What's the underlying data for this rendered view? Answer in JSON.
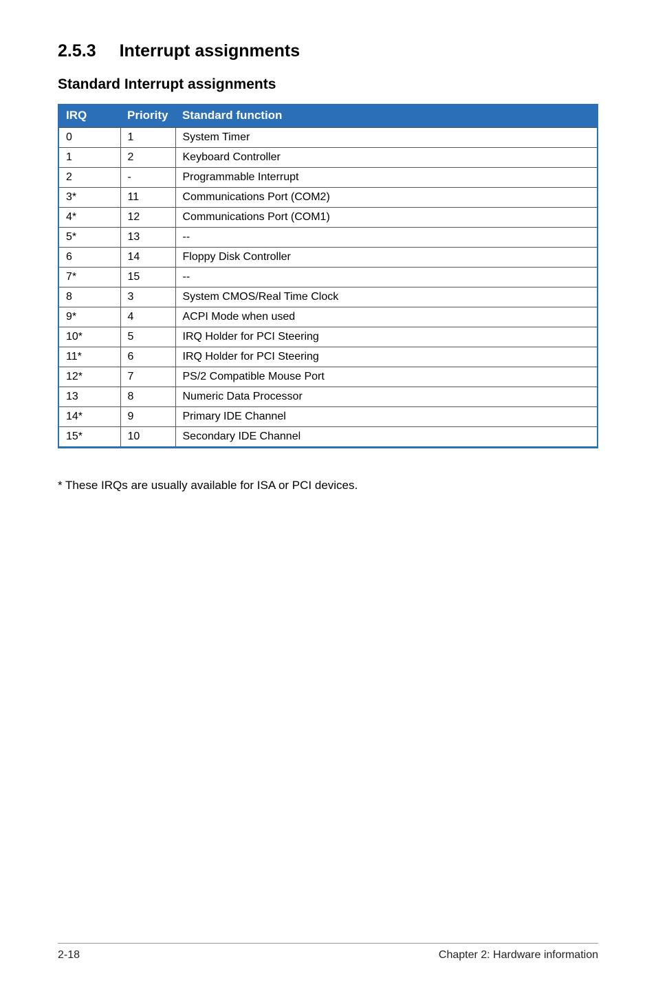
{
  "heading": {
    "number": "2.5.3",
    "title": "Interrupt assignments"
  },
  "subheading": "Standard Interrupt assignments",
  "table": {
    "headers": {
      "irq": "IRQ",
      "priority": "Priority",
      "func": "Standard function"
    },
    "rows": [
      {
        "irq": "0",
        "priority": "1",
        "func": "System Timer"
      },
      {
        "irq": "1",
        "priority": "2",
        "func": "Keyboard Controller"
      },
      {
        "irq": "2",
        "priority": "-",
        "func": "Programmable Interrupt"
      },
      {
        "irq": "3*",
        "priority": "11",
        "func": "Communications Port (COM2)"
      },
      {
        "irq": "4*",
        "priority": "12",
        "func": "Communications Port (COM1)"
      },
      {
        "irq": "5*",
        "priority": "13",
        "func": "--"
      },
      {
        "irq": "6",
        "priority": "14",
        "func": "Floppy Disk Controller"
      },
      {
        "irq": "7*",
        "priority": "15",
        "func": "--"
      },
      {
        "irq": "8",
        "priority": "3",
        "func": "System CMOS/Real Time Clock"
      },
      {
        "irq": "9*",
        "priority": "4",
        "func": "ACPI Mode when used"
      },
      {
        "irq": "10*",
        "priority": "5",
        "func": "IRQ Holder for PCI Steering"
      },
      {
        "irq": "11*",
        "priority": "6",
        "func": "IRQ Holder for PCI Steering"
      },
      {
        "irq": "12*",
        "priority": "7",
        "func": "PS/2 Compatible Mouse Port"
      },
      {
        "irq": "13",
        "priority": "8",
        "func": "Numeric Data Processor"
      },
      {
        "irq": "14*",
        "priority": "9",
        "func": "Primary IDE Channel"
      },
      {
        "irq": "15*",
        "priority": "10",
        "func": "Secondary IDE Channel"
      }
    ]
  },
  "footnote": "* These IRQs are usually available for ISA or PCI devices.",
  "footer": {
    "left": "2-18",
    "right": "Chapter 2: Hardware information"
  }
}
